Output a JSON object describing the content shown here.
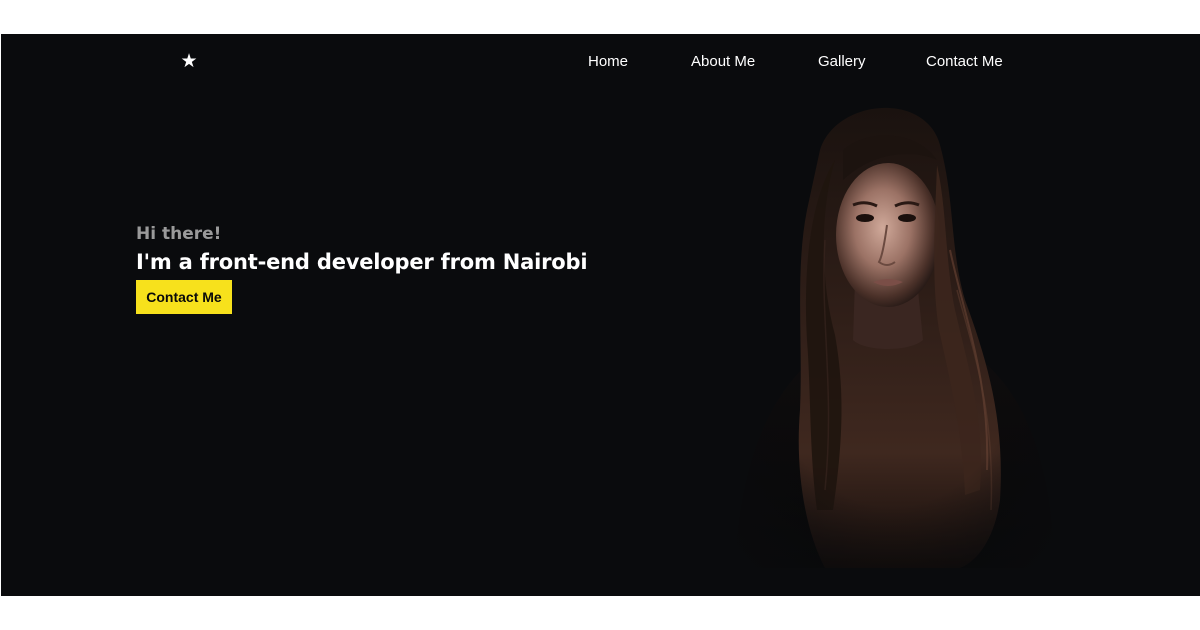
{
  "header": {
    "logo_icon": "star-icon",
    "nav": [
      {
        "label": "Home"
      },
      {
        "label": "About Me"
      },
      {
        "label": "Gallery"
      },
      {
        "label": "Contact Me"
      }
    ]
  },
  "hero": {
    "greeting": "Hi there!",
    "headline": "I'm a front-end developer from Nairobi",
    "cta_label": "Contact Me",
    "portrait_icon": "portrait-photo"
  },
  "colors": {
    "background": "#0a0b0d",
    "accent": "#f7e11c",
    "text": "#ffffff",
    "muted_text": "#9a9a9a"
  }
}
